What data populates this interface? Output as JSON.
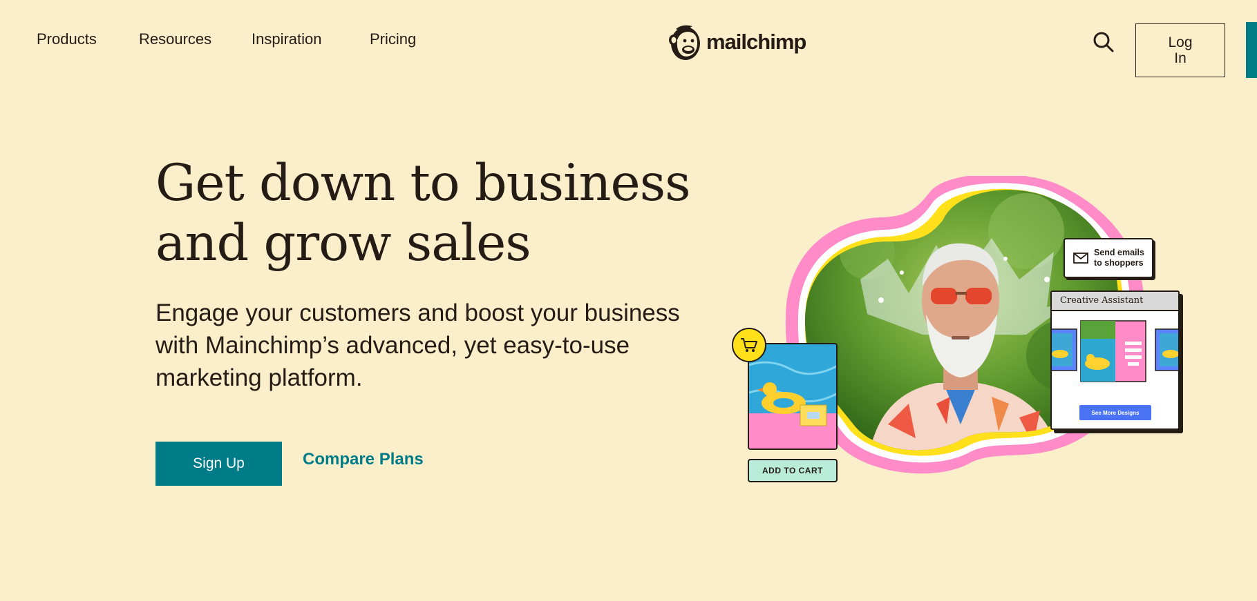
{
  "header": {
    "nav": [
      {
        "label": "Products"
      },
      {
        "label": "Resources"
      },
      {
        "label": "Inspiration"
      },
      {
        "label": "Pricing"
      }
    ],
    "logo_text": "mailchimp",
    "login_label": "Log In",
    "icons": {
      "search": "search-icon",
      "logo": "freddie-monkey-logo"
    }
  },
  "hero": {
    "title": "Get down to business and grow sales",
    "subtitle": "Engage your customers and boost your business with Mainchimp’s advanced, yet easy-to-use marketing platform.",
    "primary_cta": "Sign Up",
    "secondary_cta": "Compare Plans"
  },
  "illustration": {
    "emails_card": "Send emails to shoppers",
    "assistant_title": "Creative Assistant",
    "assistant_button": "See More Designs",
    "add_to_cart": "ADD TO CART",
    "icons": {
      "envelope": "envelope-icon",
      "cart": "cart-icon"
    }
  },
  "colors": {
    "background": "#fbeecb",
    "brand_teal": "#007c89",
    "text": "#241c15",
    "pink": "#ff8cc8",
    "yellow": "#ffe01b",
    "blue_button": "#4a72f5",
    "mint": "#b8ecd9"
  }
}
